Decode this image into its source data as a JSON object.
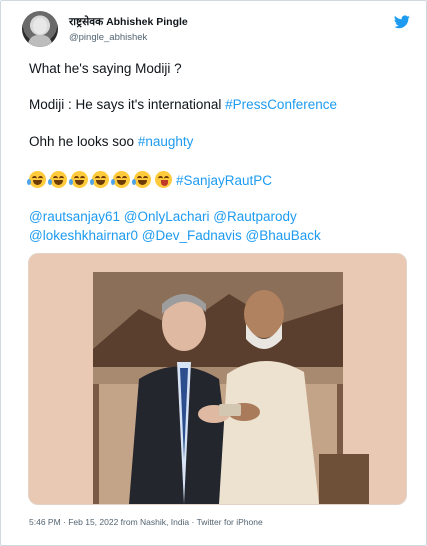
{
  "author": {
    "display_name": "राष्ट्रसेवक Abhishek Pingle",
    "handle": "@pingle_abhishek"
  },
  "tweet": {
    "line1": "What he's saying Modiji ?",
    "line2_prefix": "Modiji : He says it's international ",
    "line2_tag": "#PressConference",
    "line3_prefix": "Ohh he looks soo ",
    "line3_tag": "#naughty",
    "emoji_tag": "#SanjayRautPC",
    "mentions_line1": "@rautsanjay61 @OnlyLachari @Rautparody",
    "mentions_line2": "@lokeshkhairnar0 @Dev_Fadnavis @BhauBack"
  },
  "emojis": [
    "face-with-tears-of-joy",
    "face-with-tears-of-joy",
    "face-with-tears-of-joy",
    "face-with-tears-of-joy",
    "face-with-tears-of-joy",
    "face-with-tears-of-joy",
    "winking-face-with-tongue"
  ],
  "photo": {
    "description_icon": "photo-two-men-looking-at-phone"
  },
  "meta": {
    "timestamp": "5:46 PM · Feb 15, 2022 from Nashik, India · Twitter for iPhone"
  },
  "colors": {
    "link": "#1d9bf0",
    "text": "#0f1419",
    "muted": "#536471",
    "photo_bg": "#e9c9b4"
  }
}
